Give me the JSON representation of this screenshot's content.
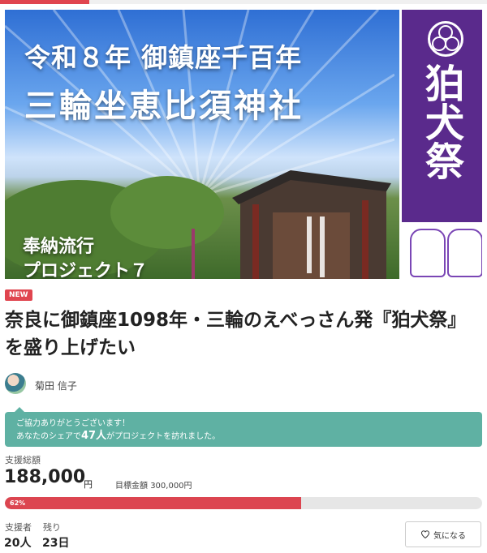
{
  "hero": {
    "title_line1": "令和８年 御鎮座千百年",
    "title_line2": "三輪坐恵比須神社",
    "banner_text": "狛犬祭",
    "sub_line1": "奉納流行",
    "sub_line2": "プロジェクト７"
  },
  "badge": "NEW",
  "project_title": "奈良に御鎮座1098年・三輪のえべっさん発『狛犬祭』を盛り上げたい",
  "author": "菊田 信子",
  "notice": {
    "line1": "ご協力ありがとうございます！",
    "line2_pre": "あなたのシェアで",
    "line2_count": "47人",
    "line2_post": "がプロジェクトを訪れました。"
  },
  "funding": {
    "raised_label": "支援総額",
    "raised_amount": "188,000",
    "yen": "円",
    "goal_label": "目標金額",
    "goal_amount": "300,000円",
    "percent_text": "62%",
    "percent": 62
  },
  "stats": {
    "supporters_label": "支援者",
    "supporters_value": "20人",
    "remaining_label": "残り",
    "remaining_value": "23日"
  },
  "fav_button": "気になる",
  "colors": {
    "accent_red": "#dc4550",
    "notice_teal": "#5fb1a3",
    "banner_purple": "#5a2a8c"
  }
}
